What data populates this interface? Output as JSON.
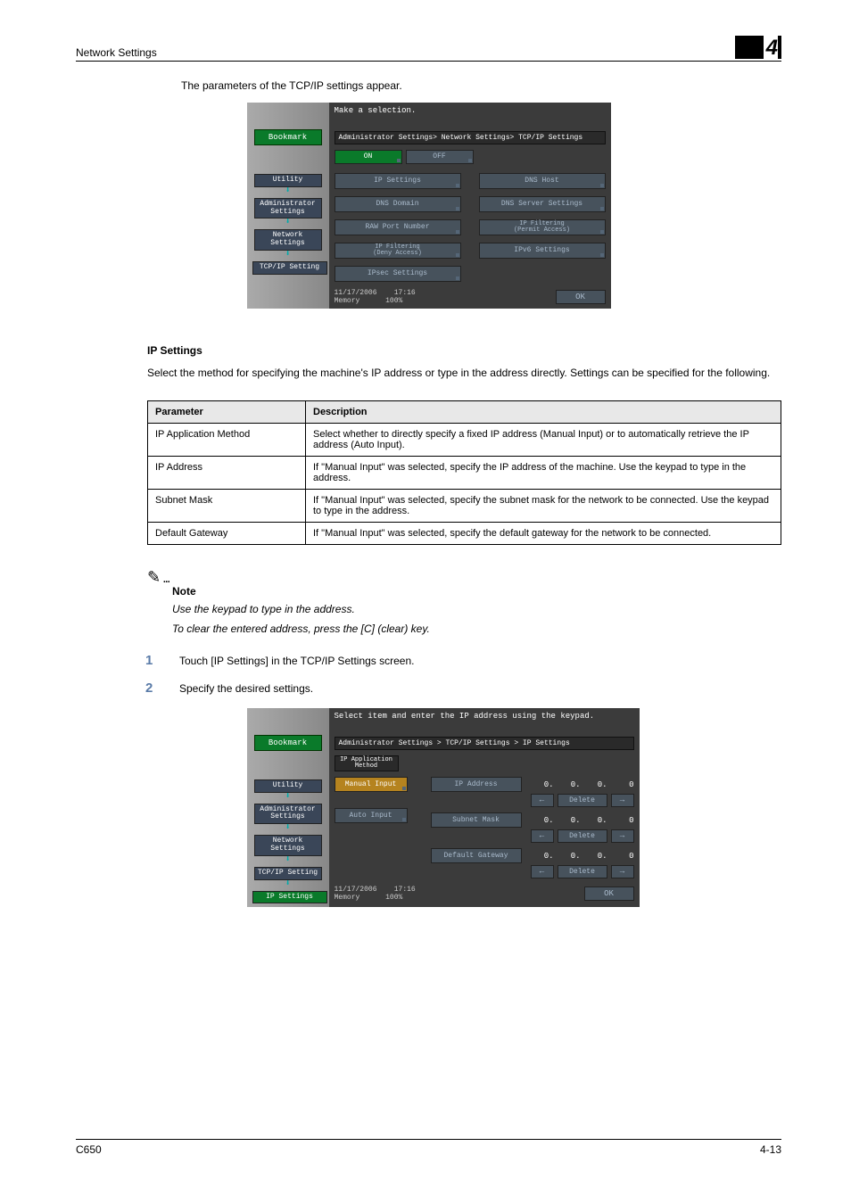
{
  "header": {
    "title": "Network Settings",
    "chapter": "4"
  },
  "intro": "The parameters of the TCP/IP settings appear.",
  "panel1": {
    "instruction": "Make a selection.",
    "bookmark": "Bookmark",
    "breadcrumb": "Administrator Settings> Network Settings> TCP/IP Settings",
    "nav": {
      "utility": "Utility",
      "admin": "Administrator\nSettings",
      "network": "Network\nSettings",
      "tcpip": "TCP/IP Setting"
    },
    "onoff": {
      "on": "ON",
      "off": "OFF"
    },
    "buttons": {
      "ip_settings": "IP Settings",
      "dns_host": "DNS Host",
      "dns_domain": "DNS Domain",
      "dns_server": "DNS Server Settings",
      "raw_port": "RAW Port Number",
      "ip_filter_permit": "IP Filtering\n(Permit Access)",
      "ip_filter_deny": "IP Filtering\n(Deny Access)",
      "ipv6": "IPv6 Settings",
      "ipsec": "IPsec Settings"
    },
    "footer": {
      "date": "11/17/2006",
      "time": "17:16",
      "memory": "Memory",
      "level": "100%",
      "ok": "OK"
    }
  },
  "section": {
    "heading": "IP Settings",
    "para": "Select the method for specifying the machine's IP address or type in the address directly. Settings can be specified for the following."
  },
  "table": {
    "header": {
      "param": "Parameter",
      "desc": "Description"
    },
    "rows": [
      {
        "param": "IP Application Method",
        "desc": "Select whether to directly specify a fixed IP address (Manual Input) or to automatically retrieve the IP address (Auto Input)."
      },
      {
        "param": "IP Address",
        "desc": "If \"Manual Input\" was selected, specify the IP address of the machine. Use the keypad to type in the address."
      },
      {
        "param": "Subnet Mask",
        "desc": "If \"Manual Input\" was selected, specify the subnet mask for the network to be connected. Use the keypad to type in the address."
      },
      {
        "param": "Default Gateway",
        "desc": "If \"Manual Input\" was selected, specify the default gateway for the network to be connected."
      }
    ]
  },
  "note": {
    "label": "Note",
    "line1": "Use the keypad to type in the address.",
    "line2": "To clear the entered address, press the [C] (clear) key."
  },
  "steps": {
    "s1": "Touch [IP Settings] in the TCP/IP Settings screen.",
    "s2": "Specify the desired settings."
  },
  "panel2": {
    "instruction": "Select item and enter the IP address using the keypad.",
    "bookmark": "Bookmark",
    "breadcrumb": "Administrator Settings > TCP/IP Settings > IP Settings",
    "method_tab": "IP Application\nMethod",
    "nav": {
      "utility": "Utility",
      "admin": "Administrator\nSettings",
      "network": "Network\nSettings",
      "tcpip": "TCP/IP Setting",
      "ipset": "IP Settings"
    },
    "methods": {
      "manual": "Manual Input",
      "auto": "Auto Input"
    },
    "fields": {
      "ip": {
        "label": "IP Address",
        "oct": [
          "0.",
          "0.",
          "0.",
          "0"
        ],
        "delete": "Delete"
      },
      "mask": {
        "label": "Subnet Mask",
        "oct": [
          "0.",
          "0.",
          "0.",
          "0"
        ],
        "delete": "Delete"
      },
      "gw": {
        "label": "Default Gateway",
        "oct": [
          "0.",
          "0.",
          "0.",
          "0"
        ],
        "delete": "Delete"
      }
    },
    "footer": {
      "date": "11/17/2006",
      "time": "17:16",
      "memory": "Memory",
      "level": "100%",
      "ok": "OK"
    }
  },
  "footer": {
    "model": "C650",
    "page": "4-13"
  }
}
